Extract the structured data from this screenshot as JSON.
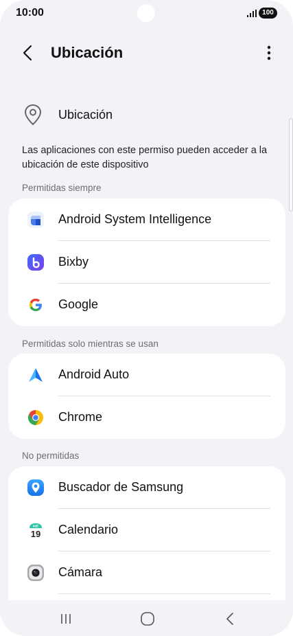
{
  "status_bar": {
    "time": "10:00",
    "battery": "100"
  },
  "app_bar": {
    "title": "Ubicación"
  },
  "master": {
    "label": "Ubicación"
  },
  "description": "Las aplicaciones con este permiso pueden acceder a la ubicación de este dispositivo",
  "sections": [
    {
      "header": "Permitidas siempre",
      "apps": [
        "Android System Intelligence",
        "Bixby",
        "Google"
      ]
    },
    {
      "header": "Permitidas solo mientras se usan",
      "apps": [
        "Android Auto",
        "Chrome"
      ]
    },
    {
      "header": "No permitidas",
      "apps": [
        "Buscador de Samsung",
        "Calendario",
        "Cámara"
      ]
    }
  ],
  "calendar_icon": {
    "day_label": "MIÉ",
    "day_number": "19"
  },
  "colors": {
    "background": "#f3f2f7",
    "card": "#ffffff",
    "divider": "#e1e1e4",
    "section_header": "#6d6d72"
  }
}
